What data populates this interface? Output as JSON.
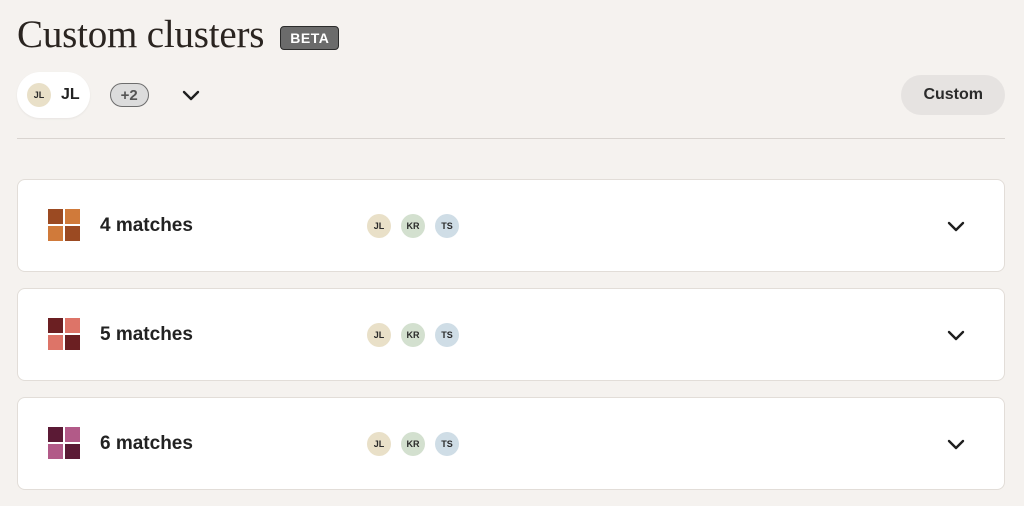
{
  "header": {
    "title": "Custom clusters",
    "badge": "BETA"
  },
  "toolbar": {
    "current_user": {
      "initials": "JL",
      "label": "JL"
    },
    "more_users": "+2",
    "expand_icon": "chevron-down-icon",
    "custom_button": "Custom"
  },
  "clusters": [
    {
      "label": "4 matches",
      "icon_colors": [
        "#9b4a22",
        "#d07a3a",
        "#d07a3a",
        "#9b4a22"
      ],
      "members": [
        "JL",
        "KR",
        "TS"
      ]
    },
    {
      "label": "5 matches",
      "icon_colors": [
        "#6b1f22",
        "#dd7468",
        "#dd7468",
        "#6b1f22"
      ],
      "members": [
        "JL",
        "KR",
        "TS"
      ]
    },
    {
      "label": "6 matches",
      "icon_colors": [
        "#5b1a35",
        "#b25a88",
        "#b25a88",
        "#5b1a35"
      ],
      "members": [
        "JL",
        "KR",
        "TS"
      ]
    }
  ]
}
